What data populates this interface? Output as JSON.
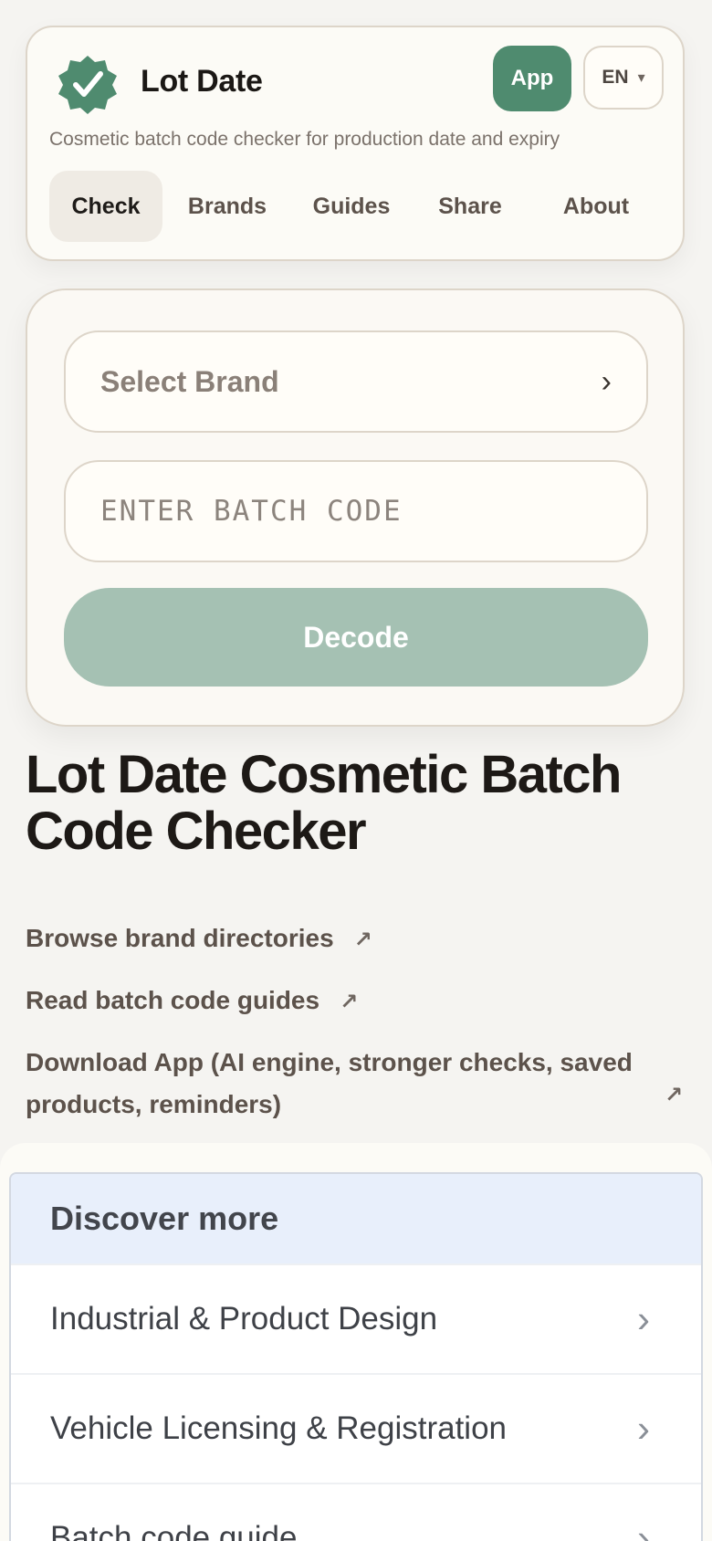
{
  "header": {
    "title": "Lot Date",
    "subtitle": "Cosmetic batch code checker for production date and expiry",
    "app_label": "App",
    "language": "EN",
    "language_caret": "▾",
    "logo_icon": "verified-badge-icon",
    "brand_color": "#4f8b6f",
    "tabs": [
      {
        "label": "Check",
        "active": true
      },
      {
        "label": "Brands",
        "active": false
      },
      {
        "label": "Guides",
        "active": false
      },
      {
        "label": "Share",
        "active": false
      },
      {
        "label": "About",
        "active": false
      }
    ]
  },
  "form": {
    "select_brand_label": "Select Brand",
    "select_chevron": "›",
    "batch_placeholder": "ENTER BATCH CODE",
    "batch_value": "",
    "decode_label": "Decode",
    "decode_color": "#a5c1b3"
  },
  "main": {
    "heading": "Lot Date Cosmetic Batch Code Checker",
    "links": [
      {
        "label": "Browse brand directories",
        "arrow": "↗"
      },
      {
        "label": "Read batch code guides",
        "arrow": "↗"
      },
      {
        "label": "Download App (AI engine, stronger checks, saved products, reminders)",
        "arrow": "↗"
      }
    ]
  },
  "discover": {
    "title": "Discover more",
    "header_color": "#e8effb",
    "items": [
      {
        "label": "Industrial & Product Design",
        "chevron": "›"
      },
      {
        "label": "Vehicle Licensing & Registration",
        "chevron": "›"
      },
      {
        "label": "Batch code guide",
        "chevron": "›"
      }
    ]
  }
}
